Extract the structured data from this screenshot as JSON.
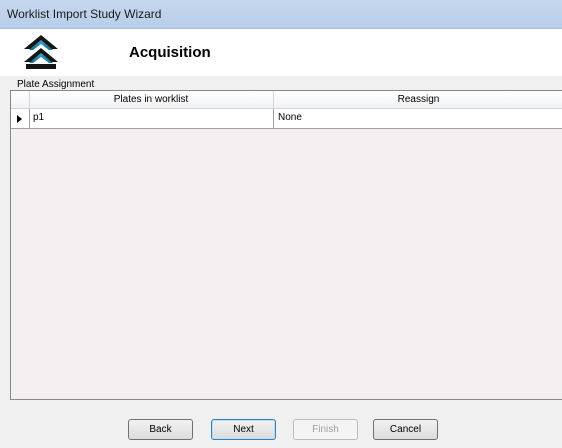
{
  "window": {
    "title": "Worklist Import Study Wizard"
  },
  "header": {
    "heading": "Acquisition",
    "logo_icon": "double-chevron-up-logo-icon",
    "accent_color": "#1a8fb5"
  },
  "plate_assignment": {
    "group_label": "Plate Assignment",
    "columns": [
      "Plates in worklist",
      "Reassign"
    ],
    "rows": [
      {
        "current_row_indicator": "row-pointer-icon",
        "plate": "p1",
        "reassign": "None"
      }
    ]
  },
  "buttons": {
    "back": "Back",
    "next": "Next",
    "finish": "Finish",
    "cancel": "Cancel",
    "finish_enabled": false
  }
}
